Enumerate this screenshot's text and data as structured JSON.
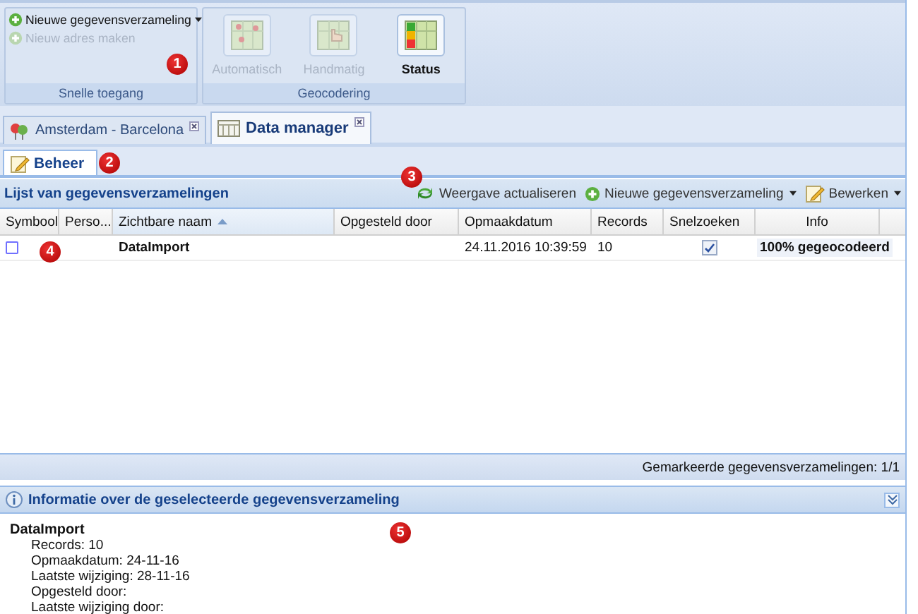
{
  "ribbon": {
    "marker": "1",
    "groups": [
      {
        "kind": "list",
        "title": "Snelle toegang",
        "items": [
          {
            "label": "Nieuwe gegevensverzameling",
            "disabled": false,
            "dropdown": true
          },
          {
            "label": "Nieuw adres maken",
            "disabled": true,
            "dropdown": false
          }
        ]
      },
      {
        "kind": "large",
        "title": "Geocodering",
        "items": [
          {
            "label": "Automatisch",
            "disabled": true,
            "selected": false
          },
          {
            "label": "Handmatig",
            "disabled": true,
            "selected": false
          },
          {
            "label": "Status",
            "disabled": false,
            "selected": true
          }
        ]
      }
    ]
  },
  "doc_tabs": [
    {
      "label": "Amsterdam - Barcelona",
      "selected": false
    },
    {
      "label": "Data manager",
      "selected": true
    }
  ],
  "sub_tabs": {
    "marker": "2",
    "tabs": [
      {
        "label": "Beheer",
        "selected": true
      }
    ]
  },
  "grid": {
    "title": "Lijst van gegevensverzamelingen",
    "marker": "3",
    "toolbar": [
      {
        "kind": "refresh",
        "label": "Weergave actualiseren",
        "dropdown": false
      },
      {
        "kind": "add",
        "label": "Nieuwe gegevensverzameling",
        "dropdown": true
      },
      {
        "kind": "edit",
        "label": "Bewerken",
        "dropdown": true
      }
    ],
    "columns": [
      {
        "label": "Symbool",
        "sorted": false
      },
      {
        "label": "Perso...",
        "sorted": false
      },
      {
        "label": "Zichtbare naam",
        "sorted": true
      },
      {
        "label": "Opgesteld door",
        "sorted": false
      },
      {
        "label": "Opmaakdatum",
        "sorted": false
      },
      {
        "label": "Records",
        "sorted": false
      },
      {
        "label": "Snelzoeken",
        "sorted": false
      },
      {
        "label": "Info",
        "sorted": false
      }
    ],
    "rows": [
      {
        "marker": "4",
        "name": "DataImport",
        "date": "24.11.2016 10:39:59",
        "records": "10",
        "quick_search": true,
        "info": "100% gegeocodeerd"
      }
    ]
  },
  "status_bar": "Gemarkeerde gegevensverzamelingen: 1/1",
  "info_panel": {
    "title": "Informatie over de geselecteerde gegevensverzameling",
    "marker": "5",
    "name": "DataImport",
    "lines": [
      "Records: 10",
      "Opmaakdatum: 24-11-16",
      "Laatste wijziging: 28-11-16",
      "Opgesteld door:",
      "Laatste wijziging door:"
    ]
  }
}
